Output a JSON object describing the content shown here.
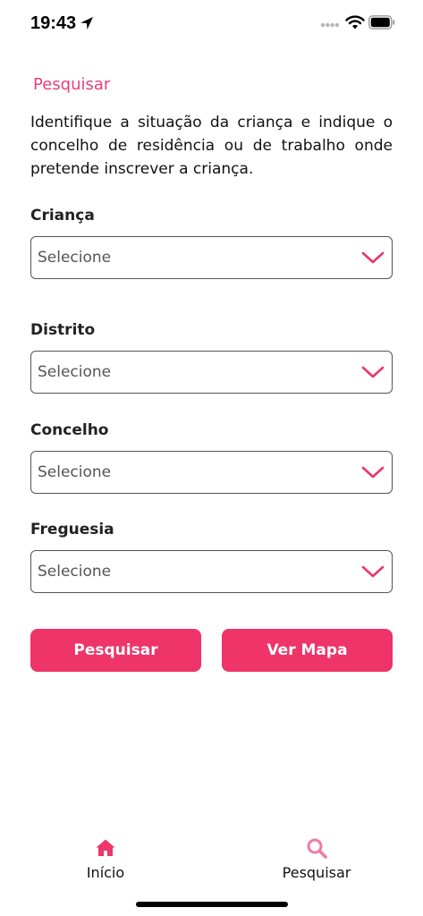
{
  "status_bar": {
    "time": "19:43",
    "icons": [
      "location-arrow-icon",
      "signal-dots-icon",
      "wifi-icon",
      "battery-icon"
    ]
  },
  "header": {
    "title": "Pesquisar"
  },
  "intro": {
    "text": "Identifique a situação da criança e indique o concelho de residência ou de trabalho onde pretende inscrever a criança."
  },
  "form": {
    "fields": [
      {
        "label": "Criança",
        "value": "Selecione"
      },
      {
        "label": "Distrito",
        "value": "Selecione"
      },
      {
        "label": "Concelho",
        "value": "Selecione"
      },
      {
        "label": "Freguesia",
        "value": "Selecione"
      }
    ]
  },
  "actions": {
    "search_label": "Pesquisar",
    "map_label": "Ver Mapa"
  },
  "tabbar": {
    "items": [
      {
        "label": "Início",
        "icon": "home-icon",
        "active": false
      },
      {
        "label": "Pesquisar",
        "icon": "search-icon",
        "active": true
      }
    ]
  },
  "colors": {
    "accent": "#ee3468",
    "title": "#e8407a",
    "tab_icon_home": "#ee3468",
    "tab_icon_search": "#f07aa0"
  }
}
